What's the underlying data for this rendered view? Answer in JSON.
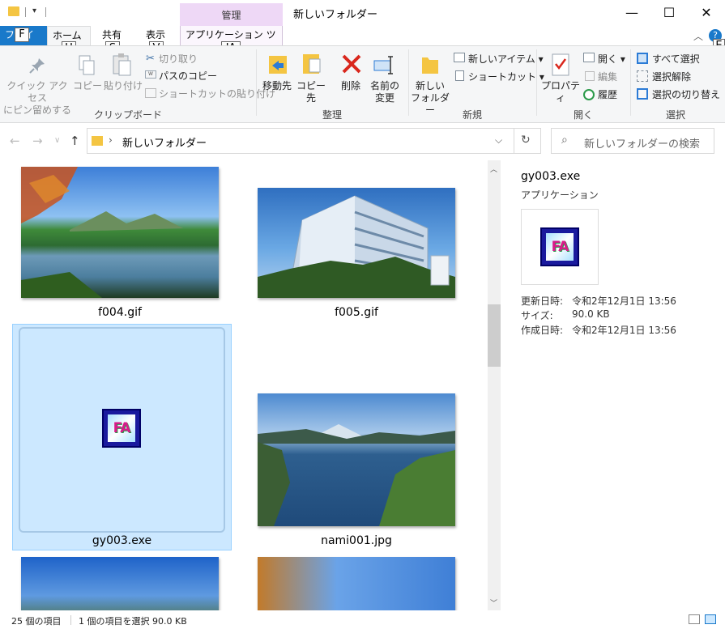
{
  "window": {
    "title": "新しいフォルダー",
    "manage_tab": "管理",
    "minimize": "—",
    "maximize": "☐",
    "close": "✕"
  },
  "ribbon_tabs": {
    "file": "ファイル",
    "home": "ホーム",
    "share": "共有",
    "view": "表示",
    "app_tools": "アプリケーション ツール"
  },
  "keytips": {
    "file": "F",
    "home": "H",
    "share": "S",
    "view": "V",
    "app_tools": "JA",
    "help": "E"
  },
  "ribbon": {
    "clipboard": {
      "label": "クリップボード",
      "pin_line1": "クイック アクセス",
      "pin_line2": "にピン留めする",
      "copy": "コピー",
      "paste": "貼り付け",
      "cut": "切り取り",
      "copy_path": "パスのコピー",
      "paste_shortcut": "ショートカットの貼り付け"
    },
    "organize": {
      "label": "整理",
      "move_to": "移動先",
      "copy_to": "コピー先",
      "delete": "削除",
      "rename_line1": "名前の",
      "rename_line2": "変更"
    },
    "new": {
      "label": "新規",
      "new_folder_line1": "新しい",
      "new_folder_line2": "フォルダー",
      "new_item": "新しいアイテム",
      "shortcut": "ショートカット"
    },
    "open": {
      "label": "開く",
      "properties": "プロパティ",
      "open": "開く",
      "edit": "編集",
      "history": "履歴"
    },
    "select": {
      "label": "選択",
      "select_all": "すべて選択",
      "select_none": "選択解除",
      "invert": "選択の切り替え"
    }
  },
  "address": {
    "path": "新しいフォルダー",
    "search_placeholder": "新しいフォルダーの検索"
  },
  "files": [
    {
      "name": "f004.gif"
    },
    {
      "name": "f005.gif"
    },
    {
      "name": "gy003.exe"
    },
    {
      "name": "nami001.jpg"
    }
  ],
  "icon_text": "FA",
  "details": {
    "name": "gy003.exe",
    "type": "アプリケーション",
    "modified_label": "更新日時:",
    "modified_value": "令和2年12月1日 13:56",
    "size_label": "サイズ:",
    "size_value": "90.0 KB",
    "created_label": "作成日時:",
    "created_value": "令和2年12月1日 13:56"
  },
  "status": {
    "count": "25 個の項目",
    "selected": "1 個の項目を選択  90.0 KB"
  },
  "colors": {
    "accent": "#1979ca",
    "selection": "#cce8ff",
    "manage_tab": "#eed8f6"
  }
}
